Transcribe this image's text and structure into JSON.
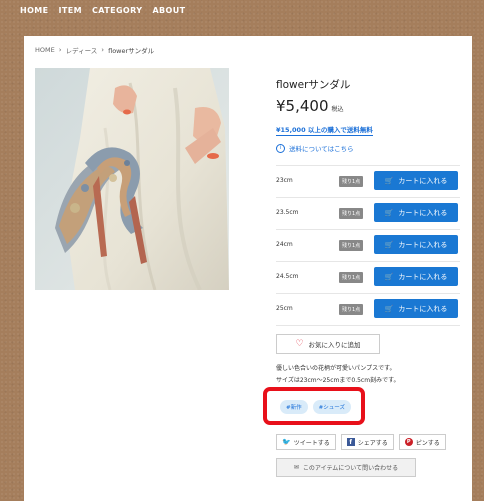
{
  "nav": {
    "items": [
      "HOME",
      "ITEM",
      "CATEGORY",
      "ABOUT"
    ]
  },
  "breadcrumb": {
    "home": "HOME",
    "category": "レディース",
    "current": "flowerサンダル",
    "separator": "›"
  },
  "product": {
    "title": "flowerサンダル",
    "price": "¥5,400",
    "tax_label": "税込",
    "free_shipping": "¥15,000 以上の購入で送料無料",
    "shipping_info": "送料についてはこちら",
    "shipping_info_icon": "info-icon"
  },
  "variants": [
    {
      "size": "23cm",
      "stock": "残り1点",
      "cart": "カートに入れる"
    },
    {
      "size": "23.5cm",
      "stock": "残り1点",
      "cart": "カートに入れる"
    },
    {
      "size": "24cm",
      "stock": "残り1点",
      "cart": "カートに入れる"
    },
    {
      "size": "24.5cm",
      "stock": "残り1点",
      "cart": "カートに入れる"
    },
    {
      "size": "25cm",
      "stock": "残り1点",
      "cart": "カートに入れる"
    }
  ],
  "favorite": {
    "label": "お気に入りに追加",
    "icon": "heart-icon"
  },
  "description": {
    "line1": "優しい色合いの花柄が可愛いパンプスです。",
    "line2": "サイズは23cm〜25cmまで0.5cm刻みです。"
  },
  "tags": [
    "#新作",
    "#シューズ"
  ],
  "share": {
    "tweet": "ツイートする",
    "facebook": "シェアする",
    "pin": "ピンする"
  },
  "inquiry": {
    "label": "このアイテムについて問い合わせる",
    "icon": "mail-icon"
  },
  "colors": {
    "accent": "#1a78d3",
    "highlight": "#e8101a",
    "background": "#a57e5c"
  }
}
